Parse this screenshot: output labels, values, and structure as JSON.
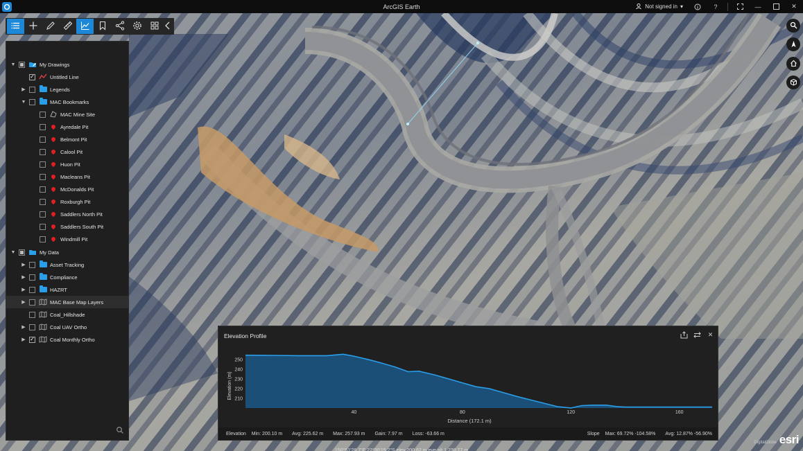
{
  "titlebar": {
    "app_title": "ArcGIS Earth",
    "signin_label": "Not signed in",
    "icons": [
      "user-icon",
      "chevron-down-icon",
      "info-icon",
      "help-icon",
      "fullscreen-icon",
      "minimize-icon",
      "maximize-icon",
      "close-icon"
    ]
  },
  "toolbar": {
    "tools": [
      "layers-list-icon",
      "add-icon",
      "draw-icon",
      "measure-icon",
      "elevation-profile-icon",
      "bookmark-icon",
      "share-icon",
      "settings-icon",
      "grid-icon",
      "collapse-icon"
    ],
    "active": "elevation-profile-icon"
  },
  "layers": [
    {
      "label": "My Drawings",
      "indent": 0,
      "caret": "open",
      "check": "partial",
      "icon": "drawings"
    },
    {
      "label": "Untitled Line",
      "indent": 1,
      "caret": "",
      "check": "checked",
      "icon": "line"
    },
    {
      "label": "Legends",
      "indent": 1,
      "caret": "closed",
      "check": "none",
      "icon": "folder"
    },
    {
      "label": "MAC Bookmarks",
      "indent": 1,
      "caret": "open",
      "check": "none",
      "icon": "folder"
    },
    {
      "label": "MAC Mine Site",
      "indent": 2,
      "caret": "",
      "check": "none",
      "icon": "area"
    },
    {
      "label": "Ayredale Pit",
      "indent": 2,
      "caret": "",
      "check": "none",
      "icon": "pin"
    },
    {
      "label": "Belmont Pit",
      "indent": 2,
      "caret": "",
      "check": "none",
      "icon": "pin"
    },
    {
      "label": "Calool Pit",
      "indent": 2,
      "caret": "",
      "check": "none",
      "icon": "pin"
    },
    {
      "label": "Huon Pit",
      "indent": 2,
      "caret": "",
      "check": "none",
      "icon": "pin"
    },
    {
      "label": "Macleans Pit",
      "indent": 2,
      "caret": "",
      "check": "none",
      "icon": "pin"
    },
    {
      "label": "McDonalds Pit",
      "indent": 2,
      "caret": "",
      "check": "none",
      "icon": "pin"
    },
    {
      "label": "Roxburgh Pit",
      "indent": 2,
      "caret": "",
      "check": "none",
      "icon": "pin"
    },
    {
      "label": "Saddlers North Pit",
      "indent": 2,
      "caret": "",
      "check": "none",
      "icon": "pin"
    },
    {
      "label": "Saddlers South Pit",
      "indent": 2,
      "caret": "",
      "check": "none",
      "icon": "pin"
    },
    {
      "label": "Windmill Pit",
      "indent": 2,
      "caret": "",
      "check": "none",
      "icon": "pin"
    },
    {
      "label": "My Data",
      "indent": 0,
      "caret": "open",
      "check": "partial",
      "icon": "data"
    },
    {
      "label": "Asset Tracking",
      "indent": 1,
      "caret": "closed",
      "check": "none",
      "icon": "folder"
    },
    {
      "label": "Compliance",
      "indent": 1,
      "caret": "closed",
      "check": "none",
      "icon": "folder"
    },
    {
      "label": "HAZRT",
      "indent": 1,
      "caret": "closed",
      "check": "none",
      "icon": "folder"
    },
    {
      "label": "MAC Base Map Layers",
      "indent": 1,
      "caret": "closed",
      "check": "none",
      "icon": "map",
      "highlight": true
    },
    {
      "label": "Coal_Hillshade",
      "indent": 1,
      "caret": "",
      "check": "none",
      "icon": "map"
    },
    {
      "label": "Coal UAV Ortho",
      "indent": 1,
      "caret": "closed",
      "check": "none",
      "icon": "map"
    },
    {
      "label": "Coal Monthly Ortho",
      "indent": 1,
      "caret": "closed",
      "check": "checked",
      "icon": "map"
    }
  ],
  "map_controls": [
    "search-icon",
    "compass-icon",
    "home-icon",
    "3d-view-icon"
  ],
  "elevation": {
    "title": "Elevation Profile",
    "actions": [
      "export-icon",
      "swap-icon",
      "close-icon"
    ],
    "stats": {
      "elev_label": "Elevation",
      "min": "Min: 200.10 m",
      "avg": "Avg: 225.62 m",
      "max": "Max: 257.93 m",
      "gain": "Gain: 7.97 m",
      "loss": "Loss: -63.66 m",
      "slope_label": "Slope",
      "slope_max": "Max: 69.72% -104.58%",
      "slope_avg": "Avg: 12.87% -56.90%"
    }
  },
  "chart_data": {
    "type": "area",
    "xlabel": "Distance (172.1  m)",
    "ylabel": "Elevation (m)",
    "xlim": [
      0,
      172.1
    ],
    "ylim": [
      200,
      260
    ],
    "xticks": [
      40,
      80,
      120,
      160
    ],
    "yticks": [
      210,
      220,
      230,
      240,
      250
    ],
    "series": [
      {
        "x": [
          0,
          10,
          20,
          30,
          36,
          40,
          46,
          50,
          55,
          60,
          64,
          70,
          75,
          80,
          85,
          90,
          95,
          100,
          105,
          110,
          115,
          120,
          124,
          128,
          133,
          137,
          140,
          145,
          150,
          155,
          160,
          165,
          172.1
        ],
        "y": [
          254.5,
          254.3,
          254,
          254,
          255.5,
          253.5,
          249.5,
          246.5,
          242.5,
          237.5,
          238,
          234,
          230,
          226,
          222,
          220,
          216,
          212,
          208.5,
          205,
          201.5,
          200.1,
          202.5,
          203,
          203,
          201.5,
          201,
          201,
          201,
          201,
          201,
          201,
          201
        ]
      }
    ],
    "colors": {
      "line": "#2a9ee8",
      "fill": "#1b4f78"
    }
  },
  "status": {
    "coords": "150°51'28.7\"E 22°30'15.2\"S  elev 200.62 m  eye alt 1,230.77 m",
    "attribution": "DigitalGlobe",
    "brand": "esri"
  }
}
